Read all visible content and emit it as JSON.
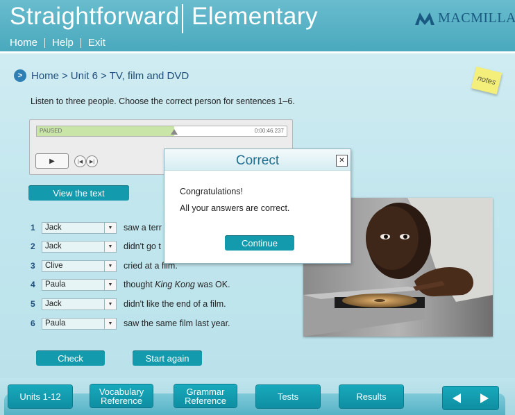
{
  "header": {
    "title_left": "Straightforward",
    "title_right": "Elementary",
    "brand": "MACMILLAN",
    "nav": [
      "Home",
      "Help",
      "Exit"
    ]
  },
  "breadcrumb": {
    "items": [
      "Home",
      "Unit 6",
      "TV, film and DVD"
    ],
    "separator": ">"
  },
  "notes_label": "notes",
  "instructions": "Listen to three people. Choose the correct person for sentences 1–6.",
  "player": {
    "status": "PAUSED",
    "time": "0:00:46.237",
    "progress": 0.55
  },
  "view_text_label": "View the text",
  "questions": [
    {
      "num": "1",
      "answer": "Jack",
      "text": "saw a terr"
    },
    {
      "num": "2",
      "answer": "Jack",
      "text": "didn't go t"
    },
    {
      "num": "3",
      "answer": "Clive",
      "text": "cried at a film."
    },
    {
      "num": "4",
      "answer": "Paula",
      "text_before": "thought ",
      "text_italic": "King Kong",
      "text_after": " was OK."
    },
    {
      "num": "5",
      "answer": "Jack",
      "text": "didn't like the end of a film."
    },
    {
      "num": "6",
      "answer": "Paula",
      "text": "saw the same film last year."
    }
  ],
  "actions": {
    "check": "Check",
    "start_again": "Start again"
  },
  "modal": {
    "title": "Correct",
    "line1": "Congratulations!",
    "line2": "All your answers are correct.",
    "continue": "Continue"
  },
  "bottom_nav": {
    "units": "Units 1-12",
    "vocab_1": "Vocabulary",
    "vocab_2": "Reference",
    "grammar_1": "Grammar",
    "grammar_2": "Reference",
    "tests": "Tests",
    "results": "Results"
  },
  "colors": {
    "header": "#4aa9bd",
    "button": "#139aad",
    "background": "#c2e6ee",
    "modal_title": "#1e6e8f"
  }
}
